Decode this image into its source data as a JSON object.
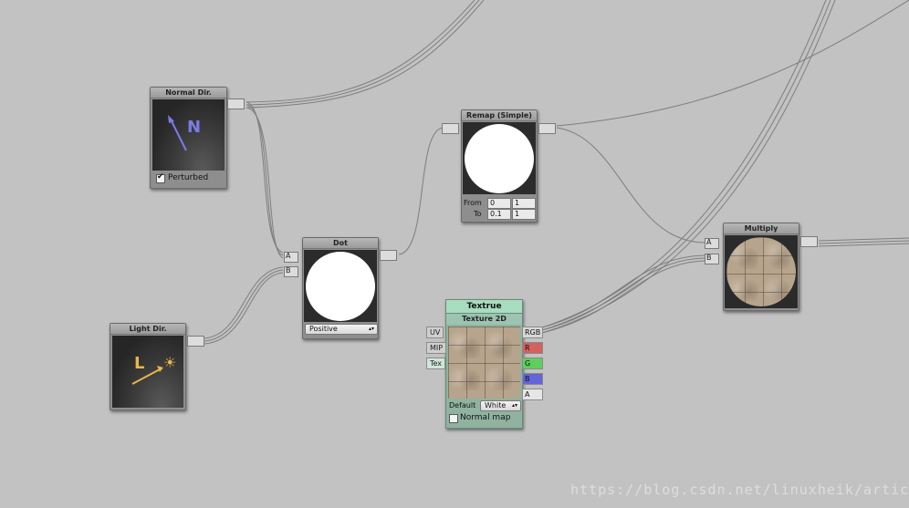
{
  "nodes": {
    "normal_dir": {
      "title": "Normal Dir.",
      "glyph": "N",
      "checkbox_label": "Perturbed",
      "checkbox_checked": true
    },
    "light_dir": {
      "title": "Light Dir.",
      "glyph": "L",
      "sun_glyph": "☀"
    },
    "dot": {
      "title": "Dot",
      "inputs": [
        "A",
        "B"
      ],
      "mode": "Positive"
    },
    "remap": {
      "title": "Remap (Simple)",
      "from_label": "From",
      "to_label": "To",
      "from_min": "0",
      "from_max": "1",
      "to_min": "0.1",
      "to_max": "1"
    },
    "texture": {
      "name": "Textrue",
      "title": "Texture 2D",
      "inputs": [
        "UV",
        "MIP",
        "Tex"
      ],
      "outputs": [
        "RGB",
        "R",
        "G",
        "B",
        "A"
      ],
      "default_label": "Default",
      "default_value": "White",
      "normal_map_label": "Normal map",
      "normal_map_checked": false
    },
    "multiply": {
      "title": "Multiply",
      "inputs": [
        "A",
        "B"
      ]
    }
  },
  "colors": {
    "canvas": "#c2c2c2",
    "node_body": "#8e8e8e",
    "texture_node": "#8fb3a0",
    "texture_name_bg": "#a8dcc0",
    "normal_glyph": "#7b7bea",
    "light_glyph": "#e8b64a",
    "port_r": "#d46060",
    "port_g": "#5fce5f",
    "port_b": "#6464d8",
    "wire": "#7e7e7e"
  },
  "watermark": "https://blog.csdn.net/linuxheik/article"
}
